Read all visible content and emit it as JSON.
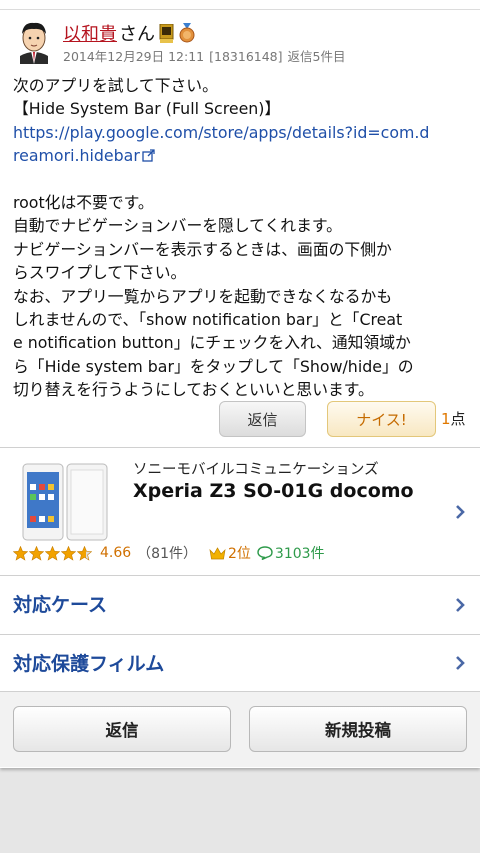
{
  "post": {
    "author_name": "以和貴",
    "author_suffix": "さん",
    "date": "2014年12月29日 12:11",
    "post_id": "[18316148]",
    "reply_label": "返信5件目",
    "body_lines": [
      "次のアプリを試して下さい。",
      "【Hide System Bar (Full Screen)】",
      "",
      "",
      "",
      "root化は不要です。",
      "自動でナビゲーションバーを隠してくれます。",
      "ナビゲーションバーを表示するときは、画面の下側か",
      "らスワイプして下さい。",
      "なお、アプリ一覧からアプリを起動できなくなるかも",
      "しれませんので、「show notification bar」と「Creat",
      "e notification button」にチェックを入れ、通知領域か",
      "ら「Hide system bar」をタップして「Show/hide」の",
      "切り替えを行うようにしておくといいと思います。"
    ],
    "link_line1": "https://play.google.com/store/apps/details?id=com.d",
    "link_line2": "reamori.hidebar",
    "reply_button": "返信",
    "nice_button": "ナイス!",
    "nice_count": "1",
    "nice_unit": "点"
  },
  "product": {
    "maker": "ソニーモバイルコミュニケーションズ",
    "name": "Xperia Z3 SO-01G docomo",
    "rating": "4.66",
    "rating_stars": 4.66,
    "reviews": "（81件）",
    "rank": "2位",
    "comments": "3103件"
  },
  "links": {
    "cases": "対応ケース",
    "films": "対応保護フィルム"
  },
  "footer": {
    "reply": "返信",
    "new_post": "新規投稿"
  },
  "colors": {
    "author": "#b5141f",
    "link": "#1f4fa8",
    "accent_orange": "#d07000",
    "comment_green": "#2e9a4a",
    "nav_blue": "#1e4a9a"
  },
  "icons": [
    "avatar",
    "badge-icon",
    "medal-icon",
    "external-link-icon",
    "star-icon",
    "crown-icon",
    "comment-bubble-icon",
    "chevron-right-icon"
  ]
}
